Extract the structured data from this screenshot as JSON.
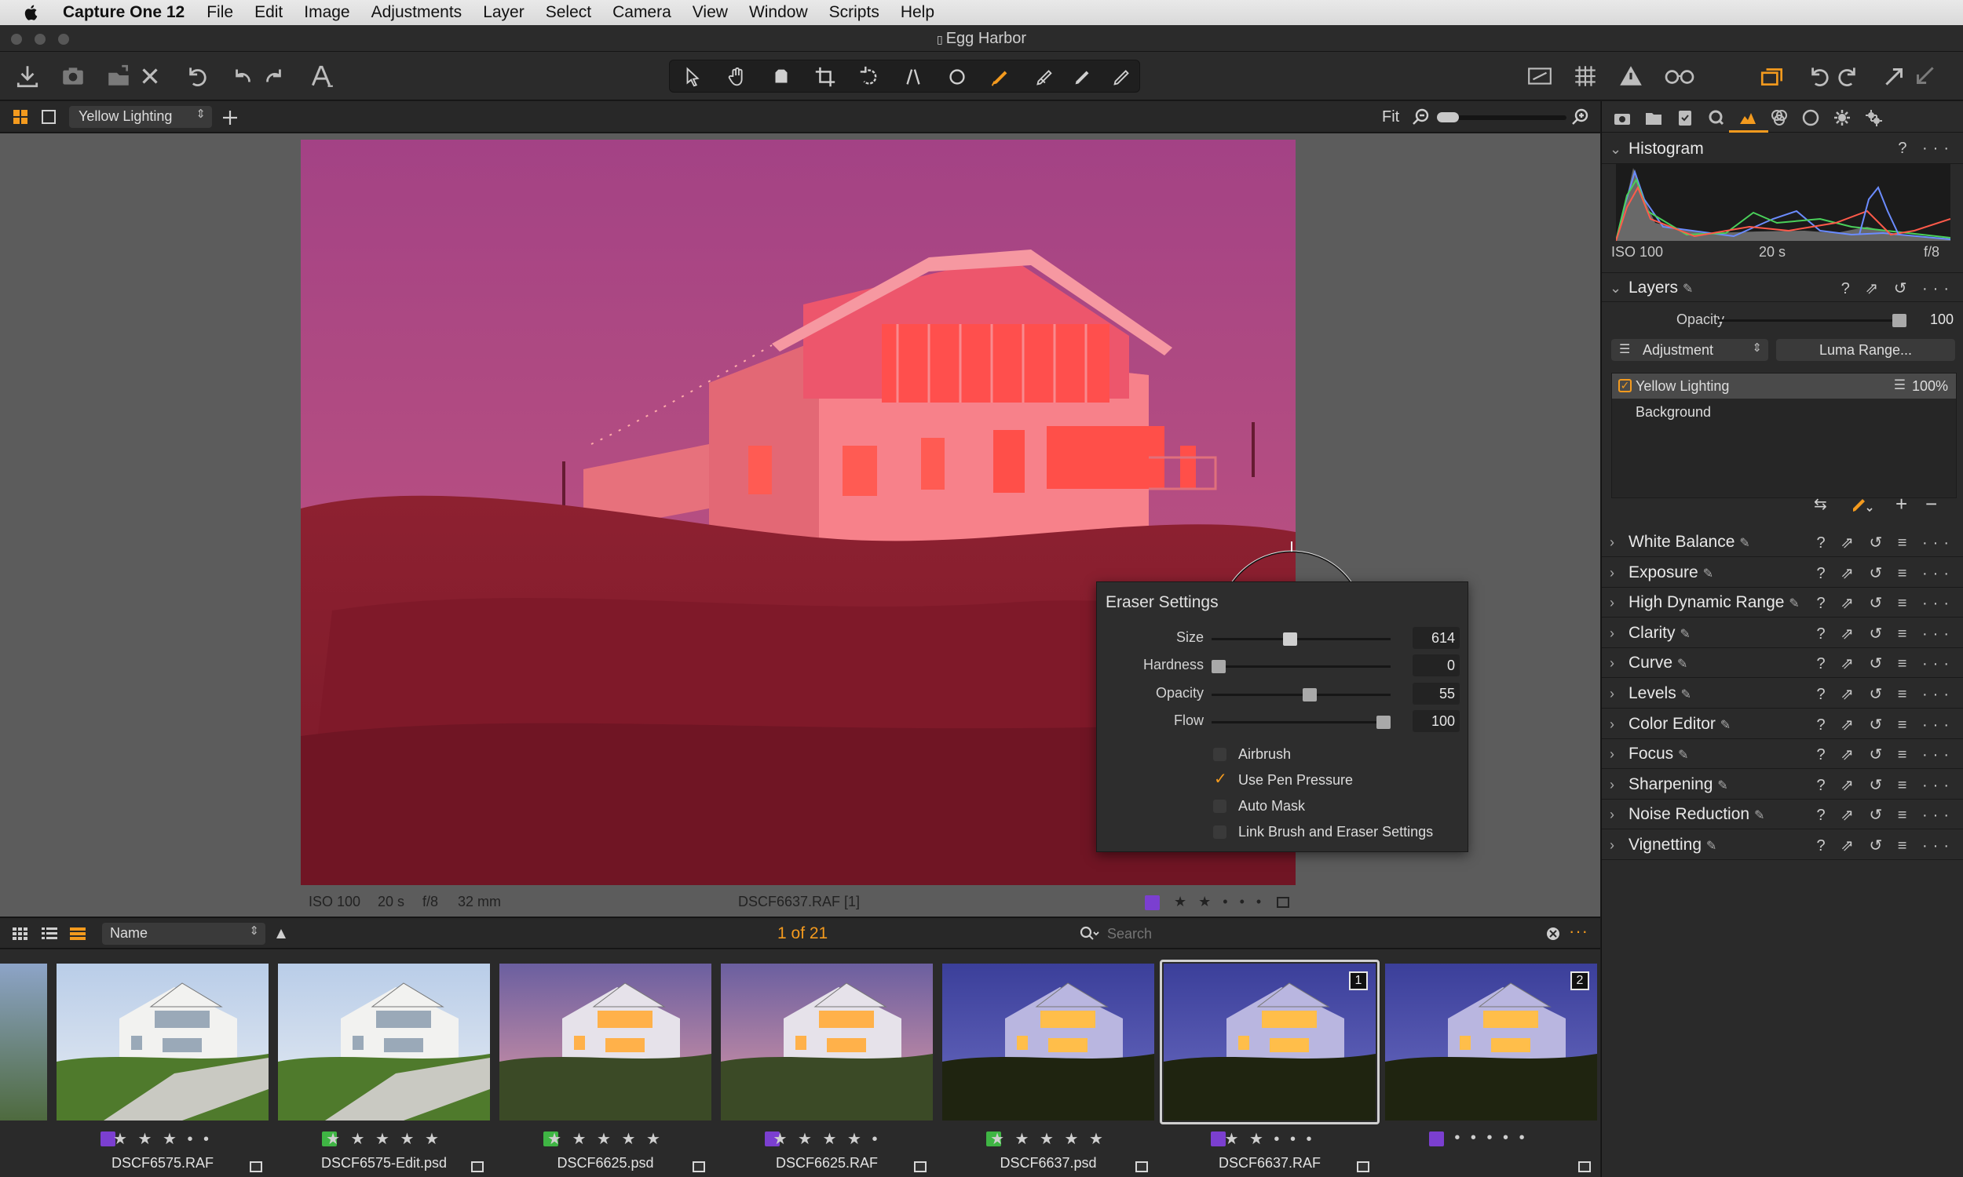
{
  "menubar": {
    "app_name": "Capture One 12",
    "items": [
      "File",
      "Edit",
      "Image",
      "Adjustments",
      "Layer",
      "Select",
      "Camera",
      "View",
      "Window",
      "Scripts",
      "Help"
    ]
  },
  "window": {
    "title": "Egg Harbor"
  },
  "viewer_bar": {
    "variant": "Yellow Lighting",
    "zoom_label": "Fit",
    "zoom_level": 0.12
  },
  "photo": {
    "iso": "ISO 100",
    "shutter": "20 s",
    "aperture": "f/8",
    "focal": "32 mm",
    "filename": "DSCF6637.RAF [1]",
    "rating_stars": "★ ★ • • •"
  },
  "eraser": {
    "title": "Eraser Settings",
    "size_label": "Size",
    "size_value": "614",
    "size_level": 0.55,
    "hardness_label": "Hardness",
    "hardness_value": "0",
    "hardness_level": 0.0,
    "opacity_label": "Opacity",
    "opacity_value": "55",
    "opacity_level": 0.55,
    "flow_label": "Flow",
    "flow_value": "100",
    "flow_level": 1.0,
    "options": [
      {
        "label": "Airbrush",
        "checked": false
      },
      {
        "label": "Use Pen Pressure",
        "checked": true
      },
      {
        "label": "Auto Mask",
        "checked": false
      },
      {
        "label": "Link Brush and Eraser Settings",
        "checked": false
      }
    ]
  },
  "browser": {
    "sort_by": "Name",
    "count": "1 of 21",
    "search_placeholder": "Search"
  },
  "filmstrip": [
    {
      "name": "DSCF6575.RAF",
      "stars": "★ ★ ★ • •",
      "color": "#7b3fd0",
      "scene": "day"
    },
    {
      "name": "DSCF6575-Edit.psd",
      "stars": "★ ★ ★ ★ ★",
      "color": "#3fb544",
      "scene": "day"
    },
    {
      "name": "DSCF6625.psd",
      "stars": "★ ★ ★ ★ ★",
      "color": "#3fb544",
      "scene": "dusk"
    },
    {
      "name": "DSCF6625.RAF",
      "stars": "★ ★ ★ ★ •",
      "color": "#7b3fd0",
      "scene": "dusk"
    },
    {
      "name": "DSCF6637.psd",
      "stars": "★ ★ ★ ★ ★",
      "color": "#3fb544",
      "scene": "night"
    },
    {
      "name": "DSCF6637.RAF",
      "stars": "★ ★ • • •",
      "color": "#7b3fd0",
      "scene": "night",
      "selected": true,
      "badge": "1"
    },
    {
      "name": "",
      "stars": "• • • • •",
      "color": "#7b3fd0",
      "scene": "night",
      "badge": "2"
    }
  ],
  "histogram": {
    "title": "Histogram",
    "iso": "ISO 100",
    "shutter": "20 s",
    "aperture": "f/8"
  },
  "layers": {
    "title": "Layers",
    "opacity_label": "Opacity",
    "opacity_value": "100",
    "opacity_level": 1.0,
    "adjustment_label": "Adjustment",
    "luma_button": "Luma Range...",
    "items": [
      {
        "name": "Yellow Lighting",
        "percent": "100%",
        "active": true
      },
      {
        "name": "Background",
        "percent": "",
        "active": false
      }
    ]
  },
  "tools": [
    "White Balance",
    "Exposure",
    "High Dynamic Range",
    "Clarity",
    "Curve",
    "Levels",
    "Color Editor",
    "Focus",
    "Sharpening",
    "Noise Reduction",
    "Vignetting"
  ],
  "colors": {
    "accent": "#f39a1e",
    "mask_overlay": "#ff2a3c",
    "sky_purple": "#8f4f9a"
  }
}
